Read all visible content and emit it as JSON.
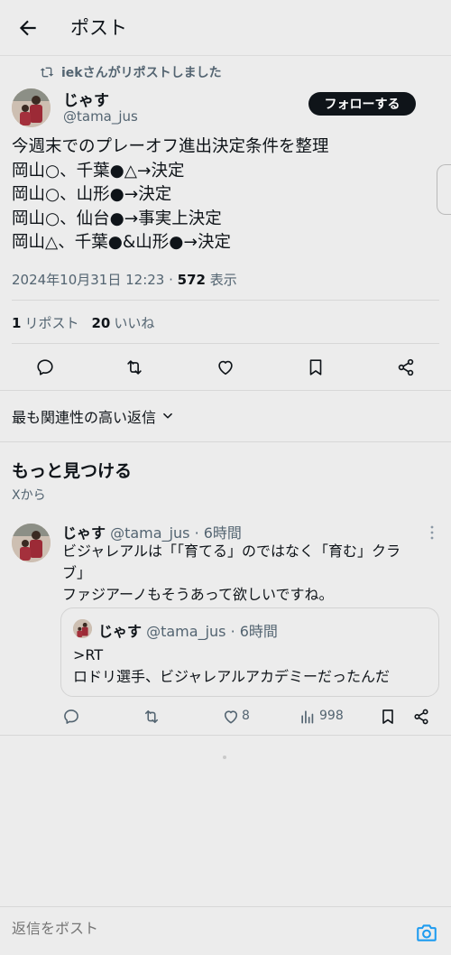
{
  "header": {
    "title": "ポスト"
  },
  "repost_notice": "iekさんがリポストしました",
  "tweet": {
    "author_name": "じゃす",
    "author_handle": "@tama_jus",
    "follow_label": "フォローする",
    "lines": [
      "今週末でのプレーオフ進出決定条件を整理",
      "岡山○、千葉●△→決定",
      "岡山○、山形●→決定",
      "岡山○、仙台●→事実上決定",
      "岡山△、千葉●&山形●→決定"
    ],
    "timestamp": "2024年10月31日 12:23 · ",
    "views_count": "572",
    "views_label": " 表示",
    "reposts_count": "1",
    "reposts_label": "リポスト",
    "likes_count": "20",
    "likes_label": "いいね"
  },
  "sort": {
    "label": "最も関連性の高い返信"
  },
  "discover": {
    "title": "もっと見つける",
    "subtitle": "Xから"
  },
  "recommended": {
    "author_name": "じゃす",
    "meta": " @tama_jus · 6時間",
    "lines": [
      "ビジャレアルは「「育てる」のではなく「育む」クラ",
      "ブ」",
      "ファジアーノもそうあって欲しいですね。"
    ],
    "quote": {
      "author_name": "じゃす",
      "meta": " @tama_jus · 6時間",
      "lines": [
        ">RT",
        "ロドリ選手、ビジャレアルアカデミーだったんだ"
      ]
    },
    "likes": "8",
    "views": "998"
  },
  "reply": {
    "placeholder": "返信をポスト"
  },
  "colors": {
    "background": "#ececec",
    "text": "#0f1419",
    "secondary": "#536471",
    "button": "#0f1419",
    "accent": "#1d9bf0"
  },
  "icons": [
    "back-arrow-icon",
    "repost-icon",
    "reply-icon",
    "like-icon",
    "bookmark-icon",
    "share-icon",
    "chevron-down-icon",
    "more-icon",
    "views-icon",
    "camera-icon"
  ]
}
